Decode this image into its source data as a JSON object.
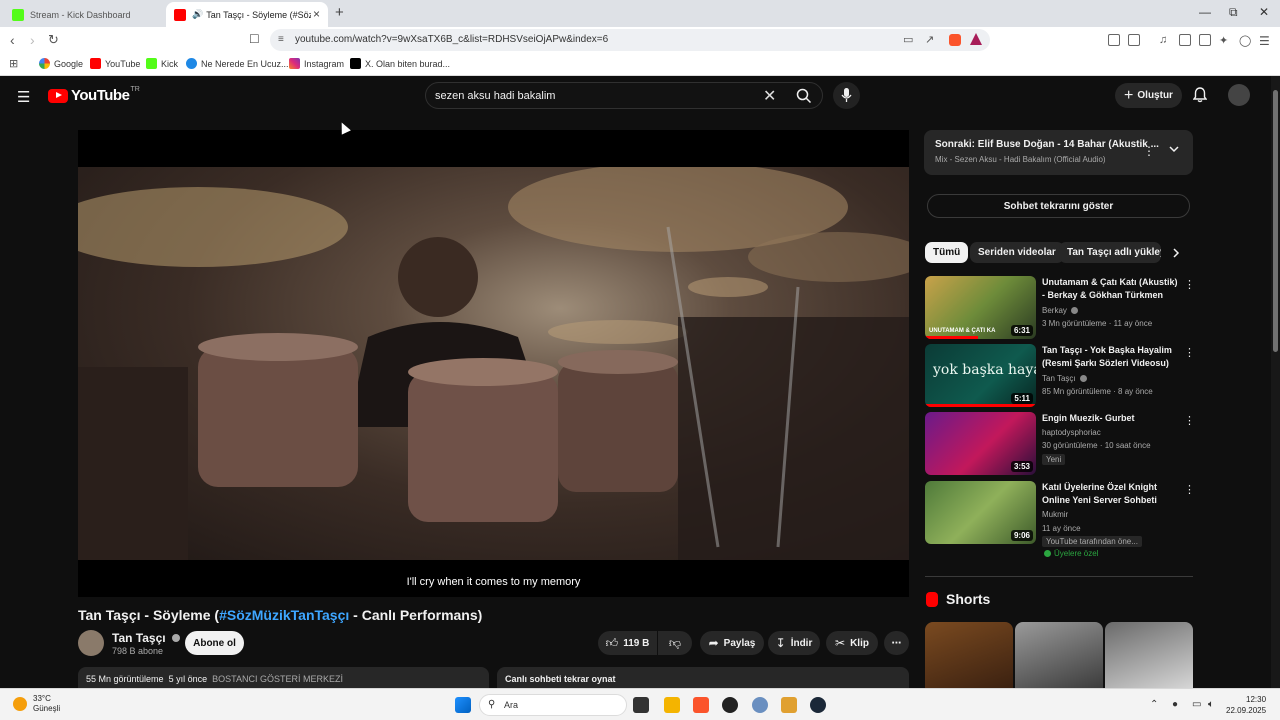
{
  "browser": {
    "tabs": [
      {
        "title": "Stream - Kick Dashboard",
        "active": false
      },
      {
        "title": "Tan Taşçı - Söyleme (#SözMü...",
        "active": true
      }
    ],
    "url": "youtube.com/watch?v=9wXsaTX6B_c&list=RDHSVseiOjAPw&index=6",
    "bookmarks": [
      "Google",
      "YouTube",
      "Kick",
      "Ne Nerede En Ucuz...",
      "Instagram",
      "X. Olan biten burad..."
    ]
  },
  "masthead": {
    "logo_text": "YouTube",
    "country_code": "TR",
    "search_value": "sezen aksu hadi bakalim",
    "create_label": "Oluştur"
  },
  "player": {
    "subtitle": "I'll cry when it comes to my memory"
  },
  "video": {
    "title_prefix": "Tan Taşçı - Söyleme (",
    "title_hashtag": "#SözMüzikTanTaşçı",
    "title_suffix": " - Canlı Performans)",
    "channel_name": "Tan Taşçı",
    "subscribers": "798 B abone",
    "subscribe_label": "Abone ol",
    "likes": "119 B",
    "share_label": "Paylaş",
    "download_label": "İndir",
    "clip_label": "Klip",
    "views": "55 Mn görüntüleme",
    "age": "5 yıl önce",
    "location": "BOSTANCI GÖSTERİ MERKEZİ",
    "chat_replay": "Canlı sohbeti tekrar oynat"
  },
  "sidebar": {
    "next_title": "Sonraki: Elif Buse Doğan - 14 Bahar (Akustik ...",
    "next_sub": "Mix - Sezen Aksu - Hadi Bakalım (Official Audio)",
    "chat_button": "Sohbet tekrarını göster",
    "chips": [
      "Tümü",
      "Seriden videolar",
      "Tan Taşçı adlı yükleyi..."
    ],
    "recommendations": [
      {
        "title": "Unutamam & Çatı Katı (Akustik) - Berkay & Gökhan Türkmen",
        "channel": "Berkay",
        "verified": true,
        "meta": "3 Mn görüntüleme · 11 ay önce",
        "duration": "6:31",
        "thumb_text": "UNUTAMAM & ÇATI KA"
      },
      {
        "title": "Tan Taşçı - Yok Başka Hayalim (Resmi Şarkı Sözleri Videosu)",
        "channel": "Tan Taşçı",
        "verified": true,
        "meta": "85 Mn görüntüleme · 8 ay önce",
        "duration": "5:11",
        "thumb_text": "yok başka hayalim"
      },
      {
        "title": "Engin Muezik- Gurbet",
        "channel": "haptodysphoriac",
        "verified": false,
        "meta": "30 görüntüleme · 10 saat önce",
        "duration": "3:53",
        "badge": "Yeni"
      },
      {
        "title": "Katıl Üyelerine Özel Knight Online Yeni Server Sohbeti",
        "channel": "Mukmir",
        "verified": false,
        "meta": "11 ay önce",
        "duration": "9:06",
        "badge": "YouTube tarafından öne...",
        "members": "Üyelere özel"
      }
    ],
    "shorts_label": "Shorts"
  },
  "taskbar": {
    "temp": "33°C",
    "weather": "Güneşli",
    "search_placeholder": "Ara",
    "time": "12:30",
    "date": "22.09.2025"
  },
  "colors": {
    "yt_red": "#ff0000",
    "link_blue": "#3ea6ff",
    "bg": "#0f0f0f"
  }
}
